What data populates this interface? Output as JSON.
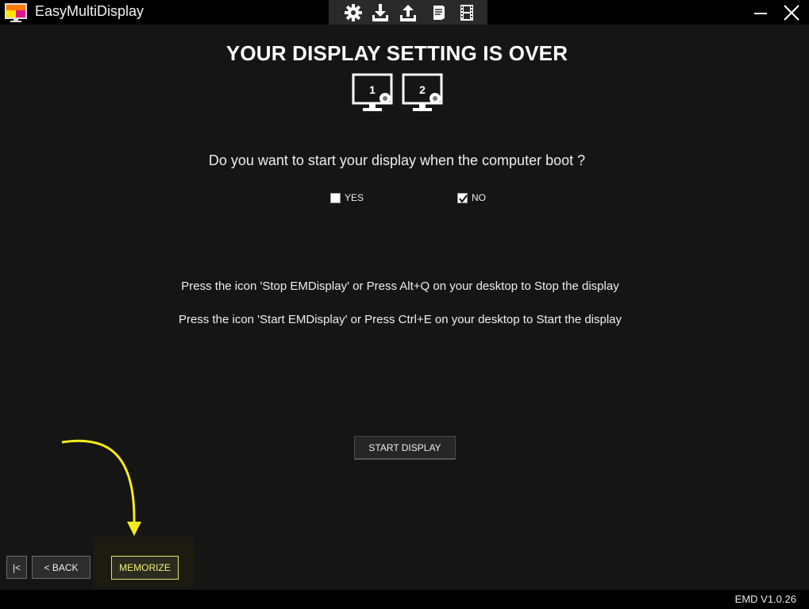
{
  "window": {
    "title": "EasyMultiDisplay",
    "toolbar_icons": [
      "gear-icon",
      "download-icon",
      "upload-icon",
      "document-icon",
      "film-icon"
    ]
  },
  "main": {
    "heading": "YOUR DISPLAY SETTING IS OVER",
    "monitors": [
      {
        "number": "1",
        "icon": "monitor-settings-icon"
      },
      {
        "number": "2",
        "icon": "monitor-settings-icon"
      }
    ],
    "question": "Do you want to start your display when the computer boot ?",
    "options": [
      {
        "label": "YES",
        "checked": false
      },
      {
        "label": "NO",
        "checked": true
      }
    ],
    "info_lines": [
      "Press the icon 'Stop EMDisplay' or Press Alt+Q on your desktop to Stop the display",
      "Press the icon 'Start EMDisplay' or Press Ctrl+E on your desktop to Start the display"
    ],
    "start_button": "START DISPLAY"
  },
  "footer": {
    "first_button": "|<",
    "back_button": "< BACK",
    "memorize_button": "MEMORIZE",
    "version": "EMD V1.0.26"
  },
  "colors": {
    "background": "#151515",
    "titlebar": "#000000",
    "highlight": "#f7ec1a",
    "memorize_border": "#e6e06a"
  }
}
